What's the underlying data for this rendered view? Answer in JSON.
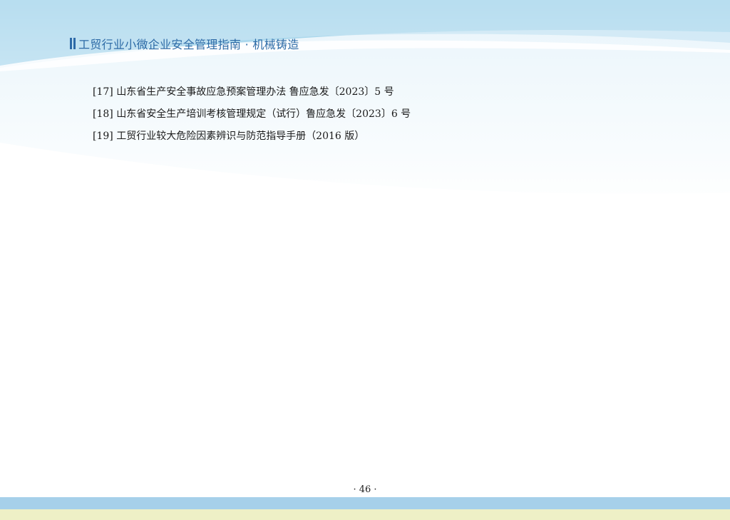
{
  "header": {
    "title": "工贸行业小微企业安全管理指南 · 机械铸造"
  },
  "references": [
    "[17] 山东省生产安全事故应急预案管理办法 鲁应急发〔2023〕5 号",
    "[18] 山东省安全生产培训考核管理规定（试行）鲁应急发〔2023〕6 号",
    "[19] 工贸行业较大危险因素辨识与防范指导手册（2016 版）"
  ],
  "footer": {
    "page_number": "· 46 ·"
  },
  "colors": {
    "header_text": "#2c6aa6",
    "footer_blue": "#a6d0ea",
    "footer_yellow": "#eef0c6"
  }
}
